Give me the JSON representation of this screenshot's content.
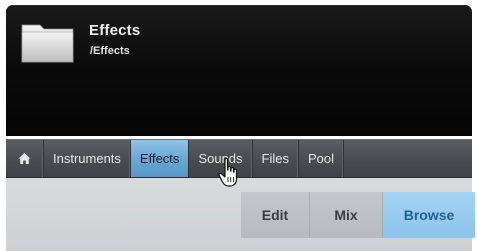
{
  "header": {
    "title": "Effects",
    "path": "/Effects",
    "icon": "folder-icon"
  },
  "tabs": {
    "home_icon": "home-icon",
    "items": [
      {
        "label": "Instruments",
        "active": false
      },
      {
        "label": "Effects",
        "active": true
      },
      {
        "label": "Sounds",
        "active": false
      },
      {
        "label": "Files",
        "active": false
      },
      {
        "label": "Pool",
        "active": false
      }
    ]
  },
  "views": {
    "edit": "Edit",
    "mix": "Mix",
    "browse": "Browse",
    "selected": "Browse"
  },
  "colors": {
    "header_bg": "#0b0b0b",
    "tab_bar_bg": "#4a4d52",
    "active_tab": "#6aa9d6",
    "browse_tab": "#8cc4ec",
    "browse_text": "#1f5f95"
  }
}
